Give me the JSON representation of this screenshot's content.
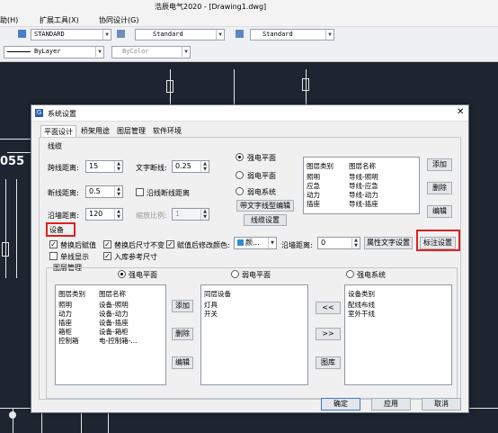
{
  "app": {
    "title": "浩辰电气2020 - [Drawing1.dwg]",
    "menu": [
      "助(H)",
      "扩展工具(X)",
      "协同设计(G)"
    ]
  },
  "toolbar": {
    "text_style": "STANDARD",
    "dim_style": "Standard",
    "table_style": "Standard",
    "linetype": "ByLayer",
    "color": "ByColor"
  },
  "canvas": {
    "label": "055"
  },
  "dialog": {
    "title": "系统设置",
    "tabs": [
      "平面设计",
      "桥架用途",
      "图层管理",
      "软件环境"
    ],
    "wiring": {
      "section_label": "线缆",
      "span_label": "跨线距离:",
      "span_value": "15",
      "break_label": "断线距离:",
      "break_value": "0.5",
      "wall_label": "沿墙距离:",
      "wall_value": "120",
      "text_break_label": "文字断线:",
      "text_break_value": "0.25",
      "along_break_label": "沿线断线距离",
      "scale_label": "缩放比例:",
      "scale_value": "1",
      "radios": [
        "强电平面",
        "弱电平面",
        "弱电系统"
      ],
      "btn_text_linetype": "带文字线型编辑",
      "btn_wire_settings": "线缆设置",
      "table_headers": [
        "图层类别",
        "图层名称"
      ],
      "rows": [
        [
          "照明",
          "导线-照明"
        ],
        [
          "应急",
          "导线-应急"
        ],
        [
          "动力",
          "导线-动力"
        ],
        [
          "插座",
          "导线-插座"
        ]
      ],
      "btn_add": "添加",
      "btn_delete": "删除",
      "btn_edit": "编辑"
    },
    "equipment": {
      "section_label": "设备",
      "replace_assign": "替换后赋值",
      "replace_keep_size": "替换后尺寸不变",
      "assign_color": "赋值后修改颜色:",
      "color_value": "颜...",
      "single_line": "单线显示",
      "ref_size": "入库参考尺寸",
      "wall_dist_label": "沿墙距离:",
      "wall_dist_value": "0",
      "btn_attr_text": "属性文字设置",
      "btn_dim_settings": "标注设置"
    },
    "layers": {
      "section_label": "图层管理",
      "radios": [
        "强电平面",
        "弱电平面",
        "强电系统"
      ],
      "left_headers": [
        "图层类别",
        "图层名称"
      ],
      "left_rows": [
        [
          "照明",
          "设备-照明"
        ],
        [
          "动力",
          "设备-动力"
        ],
        [
          "插座",
          "设备-插座"
        ],
        [
          "箱柜",
          "设备-箱柜"
        ],
        [
          "控制箱",
          "电-控制箱-..."
        ]
      ],
      "btn_add": "添加",
      "btn_delete": "删除",
      "btn_edit": "编辑",
      "mid_header": "同层设备",
      "mid_rows": [
        "灯具",
        "开关"
      ],
      "btn_left": "<<",
      "btn_right": ">>",
      "btn_library": "图库",
      "right_header": "设备类别",
      "right_rows": [
        "配线布线",
        "室外干线"
      ]
    },
    "footer": {
      "ok": "确定",
      "apply": "应用",
      "cancel": "取消"
    }
  }
}
